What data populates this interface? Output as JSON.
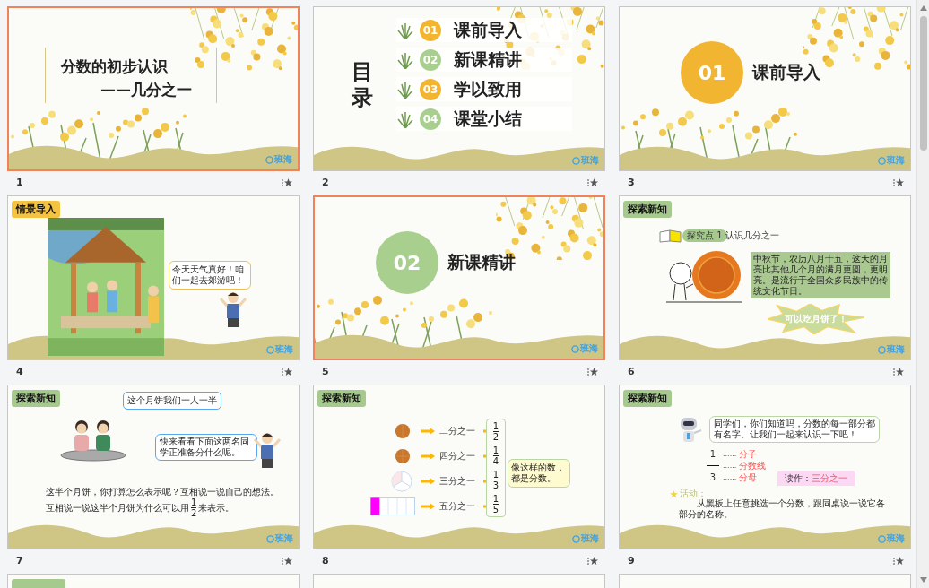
{
  "slides": [
    {
      "kind": "title",
      "number": "1",
      "selected": true,
      "title": "分数的初步认识",
      "subtitle": "——几分之一",
      "logo": "班海"
    },
    {
      "kind": "toc",
      "number": "2",
      "selected": false,
      "heading": [
        "目",
        "录"
      ],
      "items": [
        {
          "num": "01",
          "label": "课前导入"
        },
        {
          "num": "02",
          "label": "新课精讲"
        },
        {
          "num": "03",
          "label": "学以致用"
        },
        {
          "num": "04",
          "label": "课堂小结"
        }
      ],
      "logo": "班海"
    },
    {
      "kind": "section",
      "number": "3",
      "selected": false,
      "num": "01",
      "label": "课前导入",
      "color": "#f2b531",
      "logo": "班海"
    },
    {
      "kind": "scene",
      "number": "4",
      "selected": false,
      "tag": {
        "text": "情景导入",
        "color": "#f5c342"
      },
      "bubble": "今天天气真好！咱们一起去郊游吧！",
      "logo": "班海"
    },
    {
      "kind": "section",
      "number": "5",
      "selected": true,
      "num": "02",
      "label": "新课精讲",
      "color": "#a9cf8f",
      "logo": "班海"
    },
    {
      "kind": "intro",
      "number": "6",
      "selected": false,
      "tag": {
        "text": "探索新知",
        "color": "#a6c98e"
      },
      "badge": "探究点 1",
      "topic": "认识几分之一",
      "paragraph": "中秋节，农历八月十五，这天的月亮比其他几个月的满月更圆，更明亮。是流行于全国众多民族中的传统文化节日。",
      "burst": "可以吃月饼了！",
      "logo": "班海"
    },
    {
      "kind": "dialog",
      "number": "7",
      "selected": false,
      "tag": {
        "text": "探索新知",
        "color": "#a6c98e"
      },
      "bubble_1": "这个月饼我们一人一半",
      "bubble_2": "快来看看下面这两名同学正准备分什么呢。",
      "line_1": "这半个月饼，你打算怎么表示呢？互相说一说自己的想法。",
      "line_2_before": "互相说一说这半个月饼为什么可以用",
      "fraction": {
        "num": "1",
        "den": "2"
      },
      "line_2_after": "来表示。",
      "logo": "班海"
    },
    {
      "kind": "fractions",
      "number": "8",
      "selected": false,
      "tag": {
        "text": "探索新知",
        "color": "#a6c98e"
      },
      "rows": [
        {
          "kind": "circle-half",
          "label": "二分之一",
          "num": "1",
          "den": "2"
        },
        {
          "kind": "circle-quarter",
          "label": "四分之一",
          "num": "1",
          "den": "4"
        },
        {
          "kind": "circle-third",
          "label": "三分之一",
          "num": "1",
          "den": "3"
        },
        {
          "kind": "bar-fifth",
          "label": "五分之一",
          "num": "1",
          "den": "5"
        }
      ],
      "note": "像这样的数，都是分数。",
      "logo": "班海"
    },
    {
      "kind": "parts",
      "number": "9",
      "selected": false,
      "tag": {
        "text": "探索新知",
        "color": "#a6c98e"
      },
      "bubble": "同学们，你们知道吗，分数的每一部分都有名字。让我们一起来认识一下吧！",
      "parts": [
        {
          "value": "1",
          "dots": "......",
          "name": "分子"
        },
        {
          "dots": "......",
          "name": "分数线"
        },
        {
          "value": "3",
          "dots": "......",
          "name": "分母"
        }
      ],
      "read_label": "读作：",
      "read_value": "三分之一",
      "activity_label": "活动：",
      "activity": "从黑板上任意挑选一个分数，跟同桌说一说它各部分的名称。",
      "logo": "班海"
    },
    {
      "kind": "partial",
      "selected": false,
      "tag": {
        "color": "#a6c98e"
      }
    },
    {
      "kind": "partial",
      "selected": false
    },
    {
      "kind": "partial",
      "selected": false
    }
  ]
}
